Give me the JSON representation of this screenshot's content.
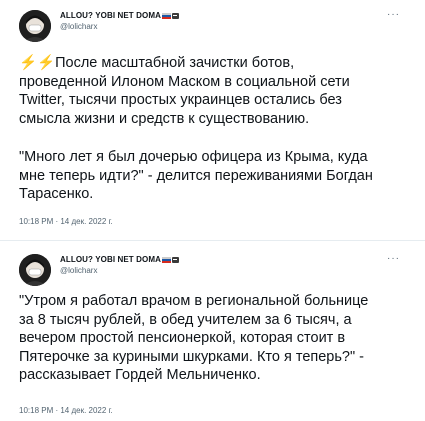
{
  "tweets": [
    {
      "author_name": "ALLOU? YOBI NET DOMA",
      "handle": "@lolicharx",
      "paragraphs": [
        [
          "⚡⚡После масштабной зачистки ботов,",
          "проведенной Илоном Маском в социальной сети",
          "Twitter, тысячи простых украинцев остались без",
          "смысла жизни и средств к существованию."
        ],
        [
          "\"Много лет я был дочерью офицера из Крыма, куда",
          "мне теперь идти?\" - делится переживаниями Богдан",
          "Тарасенко."
        ]
      ],
      "timestamp": "10:18 PM · 14 дек. 2022 г."
    },
    {
      "author_name": "ALLOU? YOBI NET DOMA",
      "handle": "@lolicharx",
      "paragraphs": [
        [
          "\"Утром я работал врачом в региональной больнице",
          "за 8 тысяч рублей, в обед учителем за 6 тысяч, а",
          "вечером простой пенсионеркой, которая стоит в",
          "Пятерочке за куриными шкурками. Кто я теперь?\" -",
          "рассказывает Гордей Мельниченко."
        ]
      ],
      "timestamp": "10:18 PM · 14 дек. 2022 г."
    }
  ],
  "more_icon": "more-horizontal-icon",
  "flag_colors": [
    "#ffffff",
    "#1c57a5",
    "#d52b1e"
  ],
  "colors": {
    "text": "#0f1419",
    "secondary": "#536471",
    "divider": "#e6ecf0",
    "lightning": "#f5b800"
  }
}
